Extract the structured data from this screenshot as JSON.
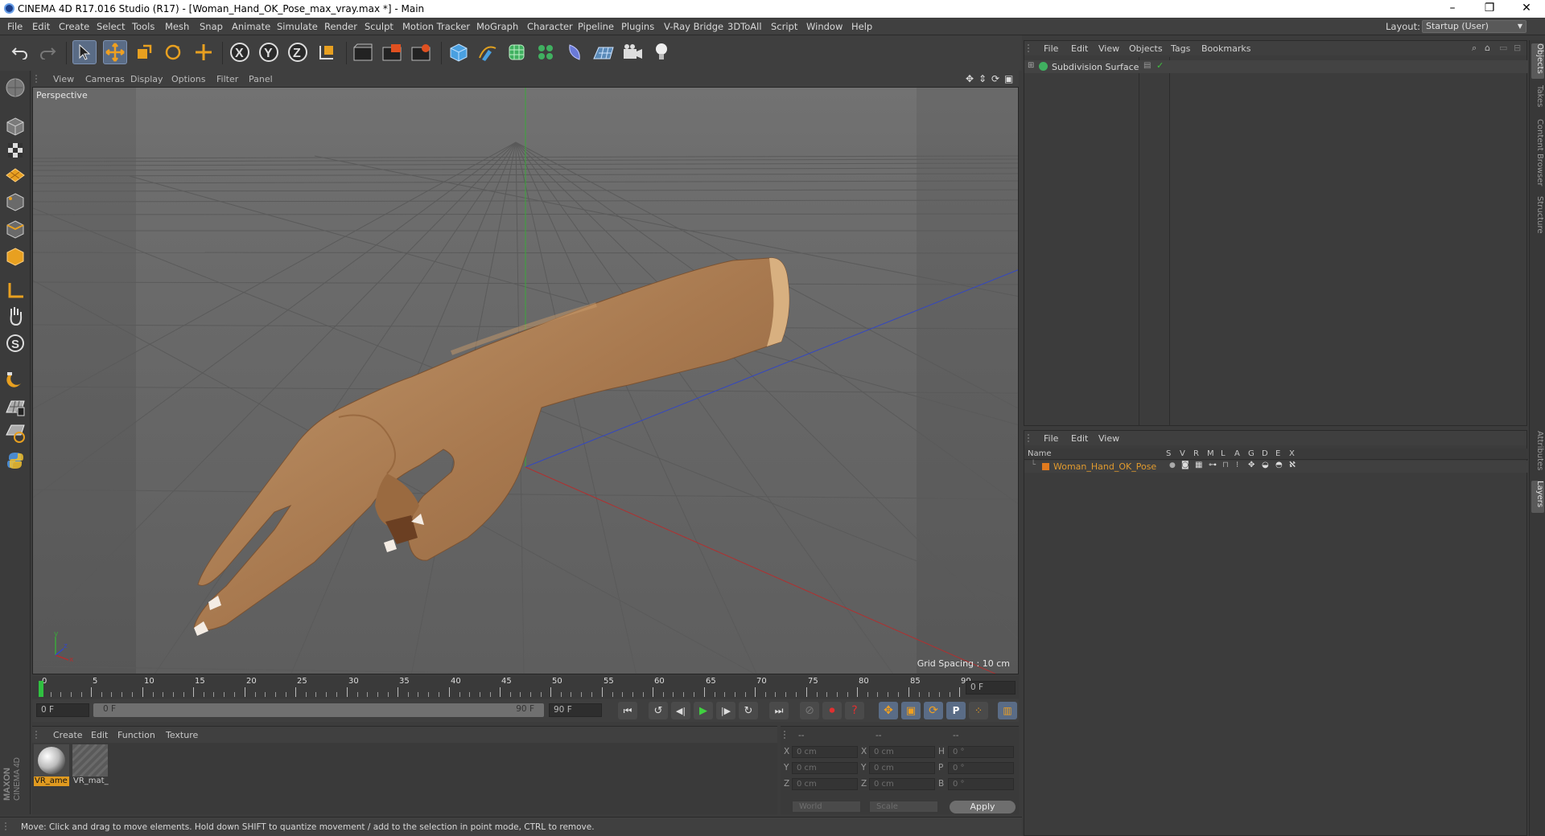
{
  "window": {
    "title": "CINEMA 4D R17.016 Studio (R17) - [Woman_Hand_OK_Pose_max_vray.max *] - Main",
    "buttons": [
      "–",
      "❐",
      "✕"
    ]
  },
  "menubar": {
    "items": [
      "File",
      "Edit",
      "Create",
      "Select",
      "Tools",
      "Mesh",
      "Snap",
      "Animate",
      "Simulate",
      "Render",
      "Sculpt",
      "Motion Tracker",
      "MoGraph",
      "Character",
      "Pipeline",
      "Plugins",
      "V-Ray Bridge",
      "3DToAll",
      "Script",
      "Window",
      "Help"
    ],
    "layout_label": "Layout:",
    "layout_value": "Startup (User)"
  },
  "toolbar": {
    "icons": [
      "undo-icon",
      "redo-icon",
      "live-selection-icon",
      "move-icon",
      "scale-icon",
      "rotate-icon",
      "recent-tools-icon",
      "x-axis-icon",
      "y-axis-icon",
      "z-axis-icon",
      "coordinate-system-icon",
      "render-view-icon",
      "render-picture-viewer-icon",
      "render-settings-icon",
      "cube-icon",
      "pen-spline-icon",
      "subdivision-icon",
      "cloner-icon",
      "deformer-icon",
      "floor-icon",
      "camera-icon",
      "light-icon"
    ]
  },
  "left_tools": {
    "icons": [
      "model-mode-icon",
      "points-mode-icon",
      "edges-mode-icon",
      "polygons-mode-icon",
      "object-mode-icon",
      "texture-mode-icon",
      "uv-mode-icon",
      "axis-icon",
      "tweak-icon",
      "snap-icon",
      "magnet-icon",
      "workplane-icon",
      "quantize-icon",
      "python-icon"
    ]
  },
  "viewport": {
    "menu": [
      "View",
      "Cameras",
      "Display",
      "Options",
      "Filter",
      "Panel"
    ],
    "camera_label": "Perspective",
    "grid_spacing": "Grid Spacing : 10 cm"
  },
  "timeline": {
    "ticks": [
      "0",
      "5",
      "10",
      "15",
      "20",
      "25",
      "30",
      "35",
      "40",
      "45",
      "50",
      "55",
      "60",
      "65",
      "70",
      "75",
      "80",
      "85",
      "90"
    ],
    "current_frame": "0 F"
  },
  "controls": {
    "start_frame": "0 F",
    "range_start": "0 F",
    "range_end": "90 F",
    "end_frame": "90 F"
  },
  "material_panel": {
    "menu": [
      "Create",
      "Edit",
      "Function",
      "Texture"
    ],
    "materials": [
      {
        "name": "VR_ame",
        "selected": true
      },
      {
        "name": "VR_mat_",
        "selected": false
      }
    ]
  },
  "coordinates": {
    "headers": [
      "--",
      "--",
      "--"
    ],
    "rows": [
      {
        "l1": "X",
        "v1": "0 cm",
        "l2": "X",
        "v2": "0 cm",
        "l3": "H",
        "v3": "0 °"
      },
      {
        "l1": "Y",
        "v1": "0 cm",
        "l2": "Y",
        "v2": "0 cm",
        "l3": "P",
        "v3": "0 °"
      },
      {
        "l1": "Z",
        "v1": "0 cm",
        "l2": "Z",
        "v2": "0 cm",
        "l3": "B",
        "v3": "0 °"
      }
    ],
    "space_dropdown": "World",
    "mode_dropdown": "Scale",
    "apply_label": "Apply"
  },
  "status": {
    "text": "Move: Click and drag to move elements. Hold down SHIFT to quantize movement / add to the selection in point mode, CTRL to remove."
  },
  "object_manager": {
    "menu": [
      "File",
      "Edit",
      "View",
      "Objects",
      "Tags",
      "Bookmarks"
    ],
    "objects": [
      {
        "name": "Subdivision Surface"
      }
    ]
  },
  "layer_manager": {
    "menu": [
      "File",
      "Edit",
      "View"
    ],
    "columns": [
      "Name",
      "S",
      "V",
      "R",
      "M",
      "L",
      "A",
      "G",
      "D",
      "E",
      "X"
    ],
    "layers": [
      {
        "name": "Woman_Hand_OK_Pose",
        "color": "#e07a1e"
      }
    ]
  },
  "right_tabs": [
    "Objects",
    "Takes",
    "Content Browser",
    "Structure",
    "Attributes",
    "Layers"
  ],
  "branding": "MAXON CINEMA 4D",
  "colors": {
    "accent": "#5a6c86",
    "layer_name": "#e09a2e",
    "x_axis": "#b03030",
    "y_axis": "#3aa83a",
    "z_axis": "#3548c0",
    "skin": "#b48a5e"
  }
}
